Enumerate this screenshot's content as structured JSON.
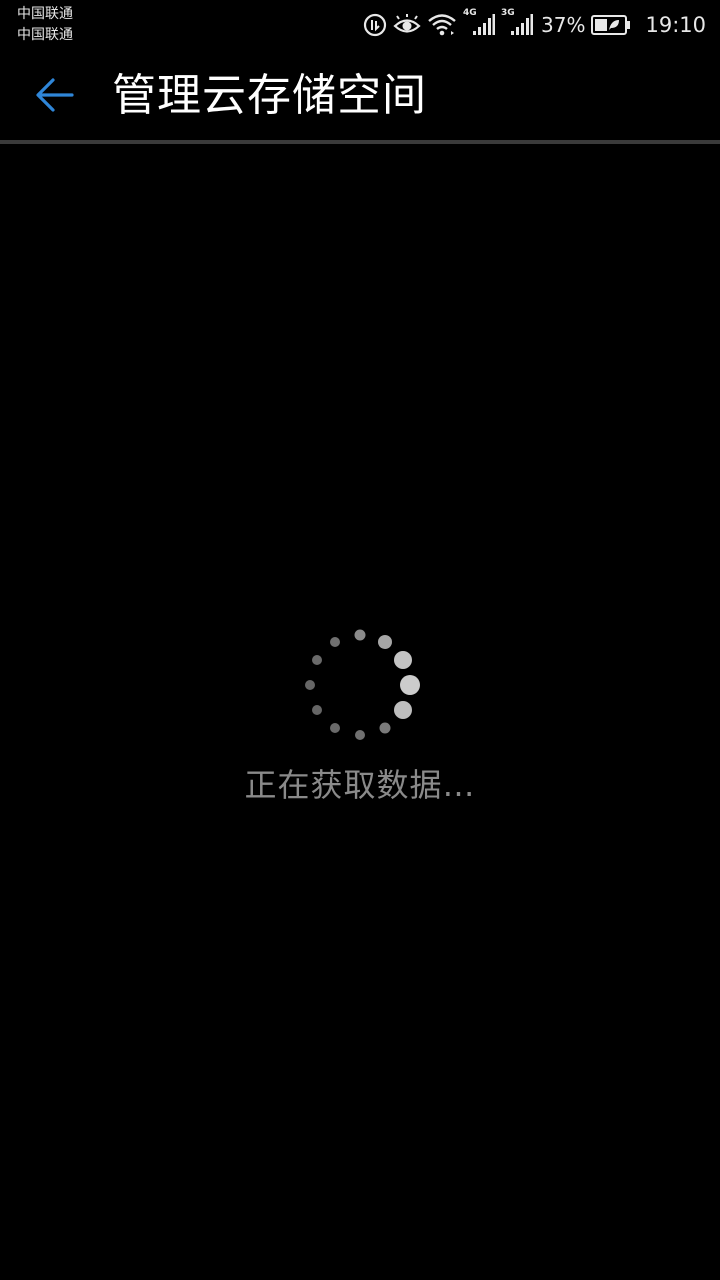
{
  "status_bar": {
    "carrier_1": "中国联通",
    "carrier_2": "中国联通",
    "network_1": "4G",
    "network_2": "3G",
    "battery_percent": "37%",
    "time": "19:10",
    "icons": [
      "data-saver-icon",
      "eye-comfort-icon",
      "wifi-icon",
      "signal-4g-icon",
      "signal-3g-icon",
      "battery-icon"
    ]
  },
  "app_bar": {
    "title": "管理云存储空间",
    "back_icon": "back-arrow-icon",
    "accent_color": "#2f86d8"
  },
  "loading": {
    "text": "正在获取数据…",
    "spinner_icon": "loading-spinner-icon"
  }
}
